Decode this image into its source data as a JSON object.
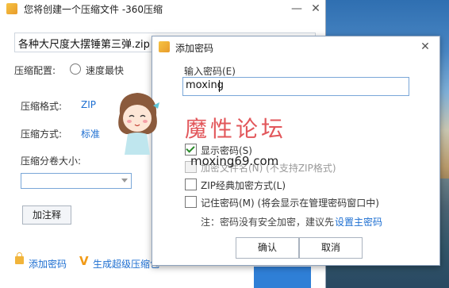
{
  "window": {
    "title": "您将创建一个压缩文件 -360压缩",
    "minimize": "—",
    "close": "✕"
  },
  "main": {
    "filename": "各种大尺度大摆锤第三弹.zip",
    "config_label": "压缩配置:",
    "config_option": "速度最快",
    "format_label": "压缩格式:",
    "format_value": "ZIP",
    "method_label": "压缩方式:",
    "method_value": "标准",
    "split_label": "压缩分卷大小:",
    "split_value": "",
    "comment_button": "加注释",
    "add_password_link": "添加密码",
    "super_compress_link": "生成超级压缩包"
  },
  "dialog": {
    "title": "添加密码",
    "close": "✕",
    "input_label": "输入密码(E)",
    "password_value": "moxing",
    "options": [
      {
        "label": "显示密码(S)",
        "checked": true,
        "disabled": false
      },
      {
        "label": "加密文件名(N) (不支持ZIP格式)",
        "checked": false,
        "disabled": true
      },
      {
        "label": "ZIP经典加密方式(L)",
        "checked": false,
        "disabled": false
      },
      {
        "label": "记住密码(M) (将会显示在管理密码窗口中)",
        "checked": false,
        "disabled": false
      }
    ],
    "note": "注：密码没有安全加密，建议先",
    "note_link": "设置主密码",
    "ok_button": "确认",
    "cancel_button": "取消"
  },
  "watermark": {
    "text": "魔性论坛",
    "url": "moxing69.com"
  },
  "colors": {
    "accent": "#1e6fd1",
    "watermark": "#e2575b"
  }
}
